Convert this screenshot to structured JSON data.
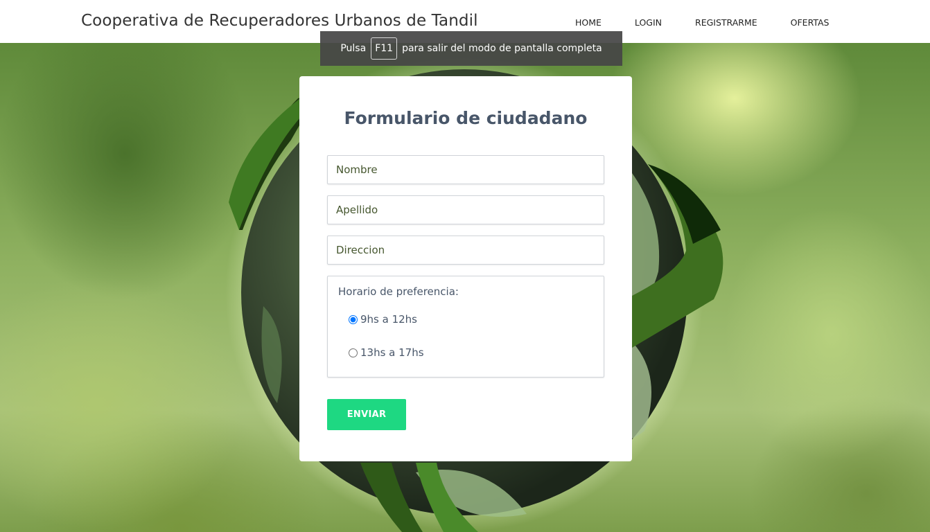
{
  "navbar": {
    "brand": "Cooperativa de Recuperadores Urbanos de Tandil",
    "links": [
      "HOME",
      "LOGIN",
      "REGISTRARME",
      "OFERTAS"
    ]
  },
  "fullscreen_notice": {
    "before": "Pulsa",
    "key": "F11",
    "after": "para salir del modo de pantalla completa"
  },
  "form": {
    "title": "Formulario de ciudadano",
    "fields": {
      "nombre_placeholder": "Nombre",
      "apellido_placeholder": "Apellido",
      "direccion_placeholder": "Direccion"
    },
    "schedule": {
      "legend": "Horario de preferencia:",
      "options": [
        "9hs a 12hs",
        "13hs a 17hs"
      ],
      "selected": "9hs a 12hs"
    },
    "submit_label": "ENVIAR"
  },
  "colors": {
    "title": "#485669",
    "button": "#1ed882",
    "navbar_bg": "#ffffff"
  },
  "icons": {
    "background": "recycling-earth-illustration"
  }
}
